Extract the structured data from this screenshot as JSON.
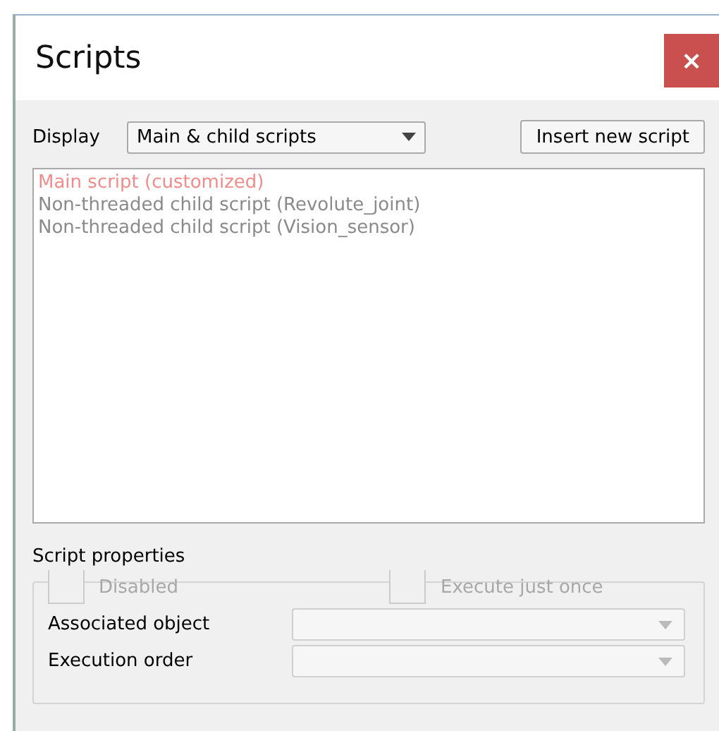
{
  "window": {
    "title": "Scripts",
    "close": "×"
  },
  "display": {
    "label": "Display",
    "value": "Main & child scripts"
  },
  "insert_button": "Insert new script",
  "scripts": [
    {
      "name": "Main script (customized)",
      "color": "#f28b8b",
      "selected": false
    },
    {
      "name": "Non-threaded child script (Revolute_joint)",
      "color": "#8a8a8a",
      "selected": false
    },
    {
      "name": "Non-threaded child script (Vision_sensor)",
      "color": "#8a8a8a",
      "selected": false
    }
  ],
  "properties": {
    "title": "Script properties",
    "checkboxes": [
      {
        "label": "Disabled",
        "checked": false,
        "disabled": true
      },
      {
        "label": "Execute just once",
        "checked": false,
        "disabled": true
      }
    ],
    "fields": [
      {
        "label": "Associated object"
      },
      {
        "label": "Execution order"
      }
    ]
  }
}
